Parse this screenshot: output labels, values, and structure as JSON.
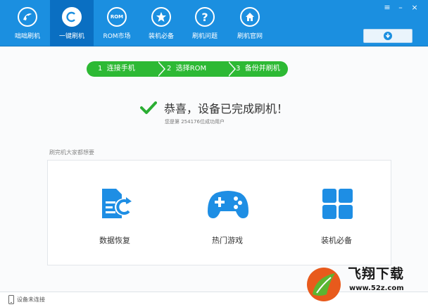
{
  "nav": {
    "items": [
      {
        "label": "咄咄刷机",
        "icon": "phone-brand-icon"
      },
      {
        "label": "一键刷机",
        "icon": "flash-c-icon"
      },
      {
        "label": "ROM市场",
        "icon": "rom-icon"
      },
      {
        "label": "装机必备",
        "icon": "star-icon"
      },
      {
        "label": "刷机问题",
        "icon": "question-icon"
      },
      {
        "label": "刷机官网",
        "icon": "home-icon"
      }
    ],
    "active_index": 1,
    "rom_icon_text": "ROM"
  },
  "window_controls": {
    "menu": "≡",
    "minimize": "–",
    "close": "×"
  },
  "steps": [
    {
      "num": "1",
      "label": "连接手机"
    },
    {
      "num": "2",
      "label": "选择ROM"
    },
    {
      "num": "3",
      "label": "备份并刷机"
    }
  ],
  "result": {
    "title": "恭喜，设备已完成刷机！",
    "subtitle": "您是第 254176位成功用户"
  },
  "recommend": {
    "title": "刷完机大家都想要",
    "items": [
      {
        "label": "数据恢复",
        "icon": "data-recovery-icon"
      },
      {
        "label": "热门游戏",
        "icon": "gamepad-icon"
      },
      {
        "label": "装机必备",
        "icon": "apps-grid-icon"
      }
    ]
  },
  "status": {
    "text": "设备未连接",
    "icon": "phone-icon"
  },
  "watermark": {
    "title": "飞翔下载",
    "url": "www.52z.com"
  },
  "colors": {
    "topbar": "#1b8fe0",
    "step_green": "#2db934",
    "icon_blue": "#1e8ee4",
    "check_green": "#2bae33"
  }
}
